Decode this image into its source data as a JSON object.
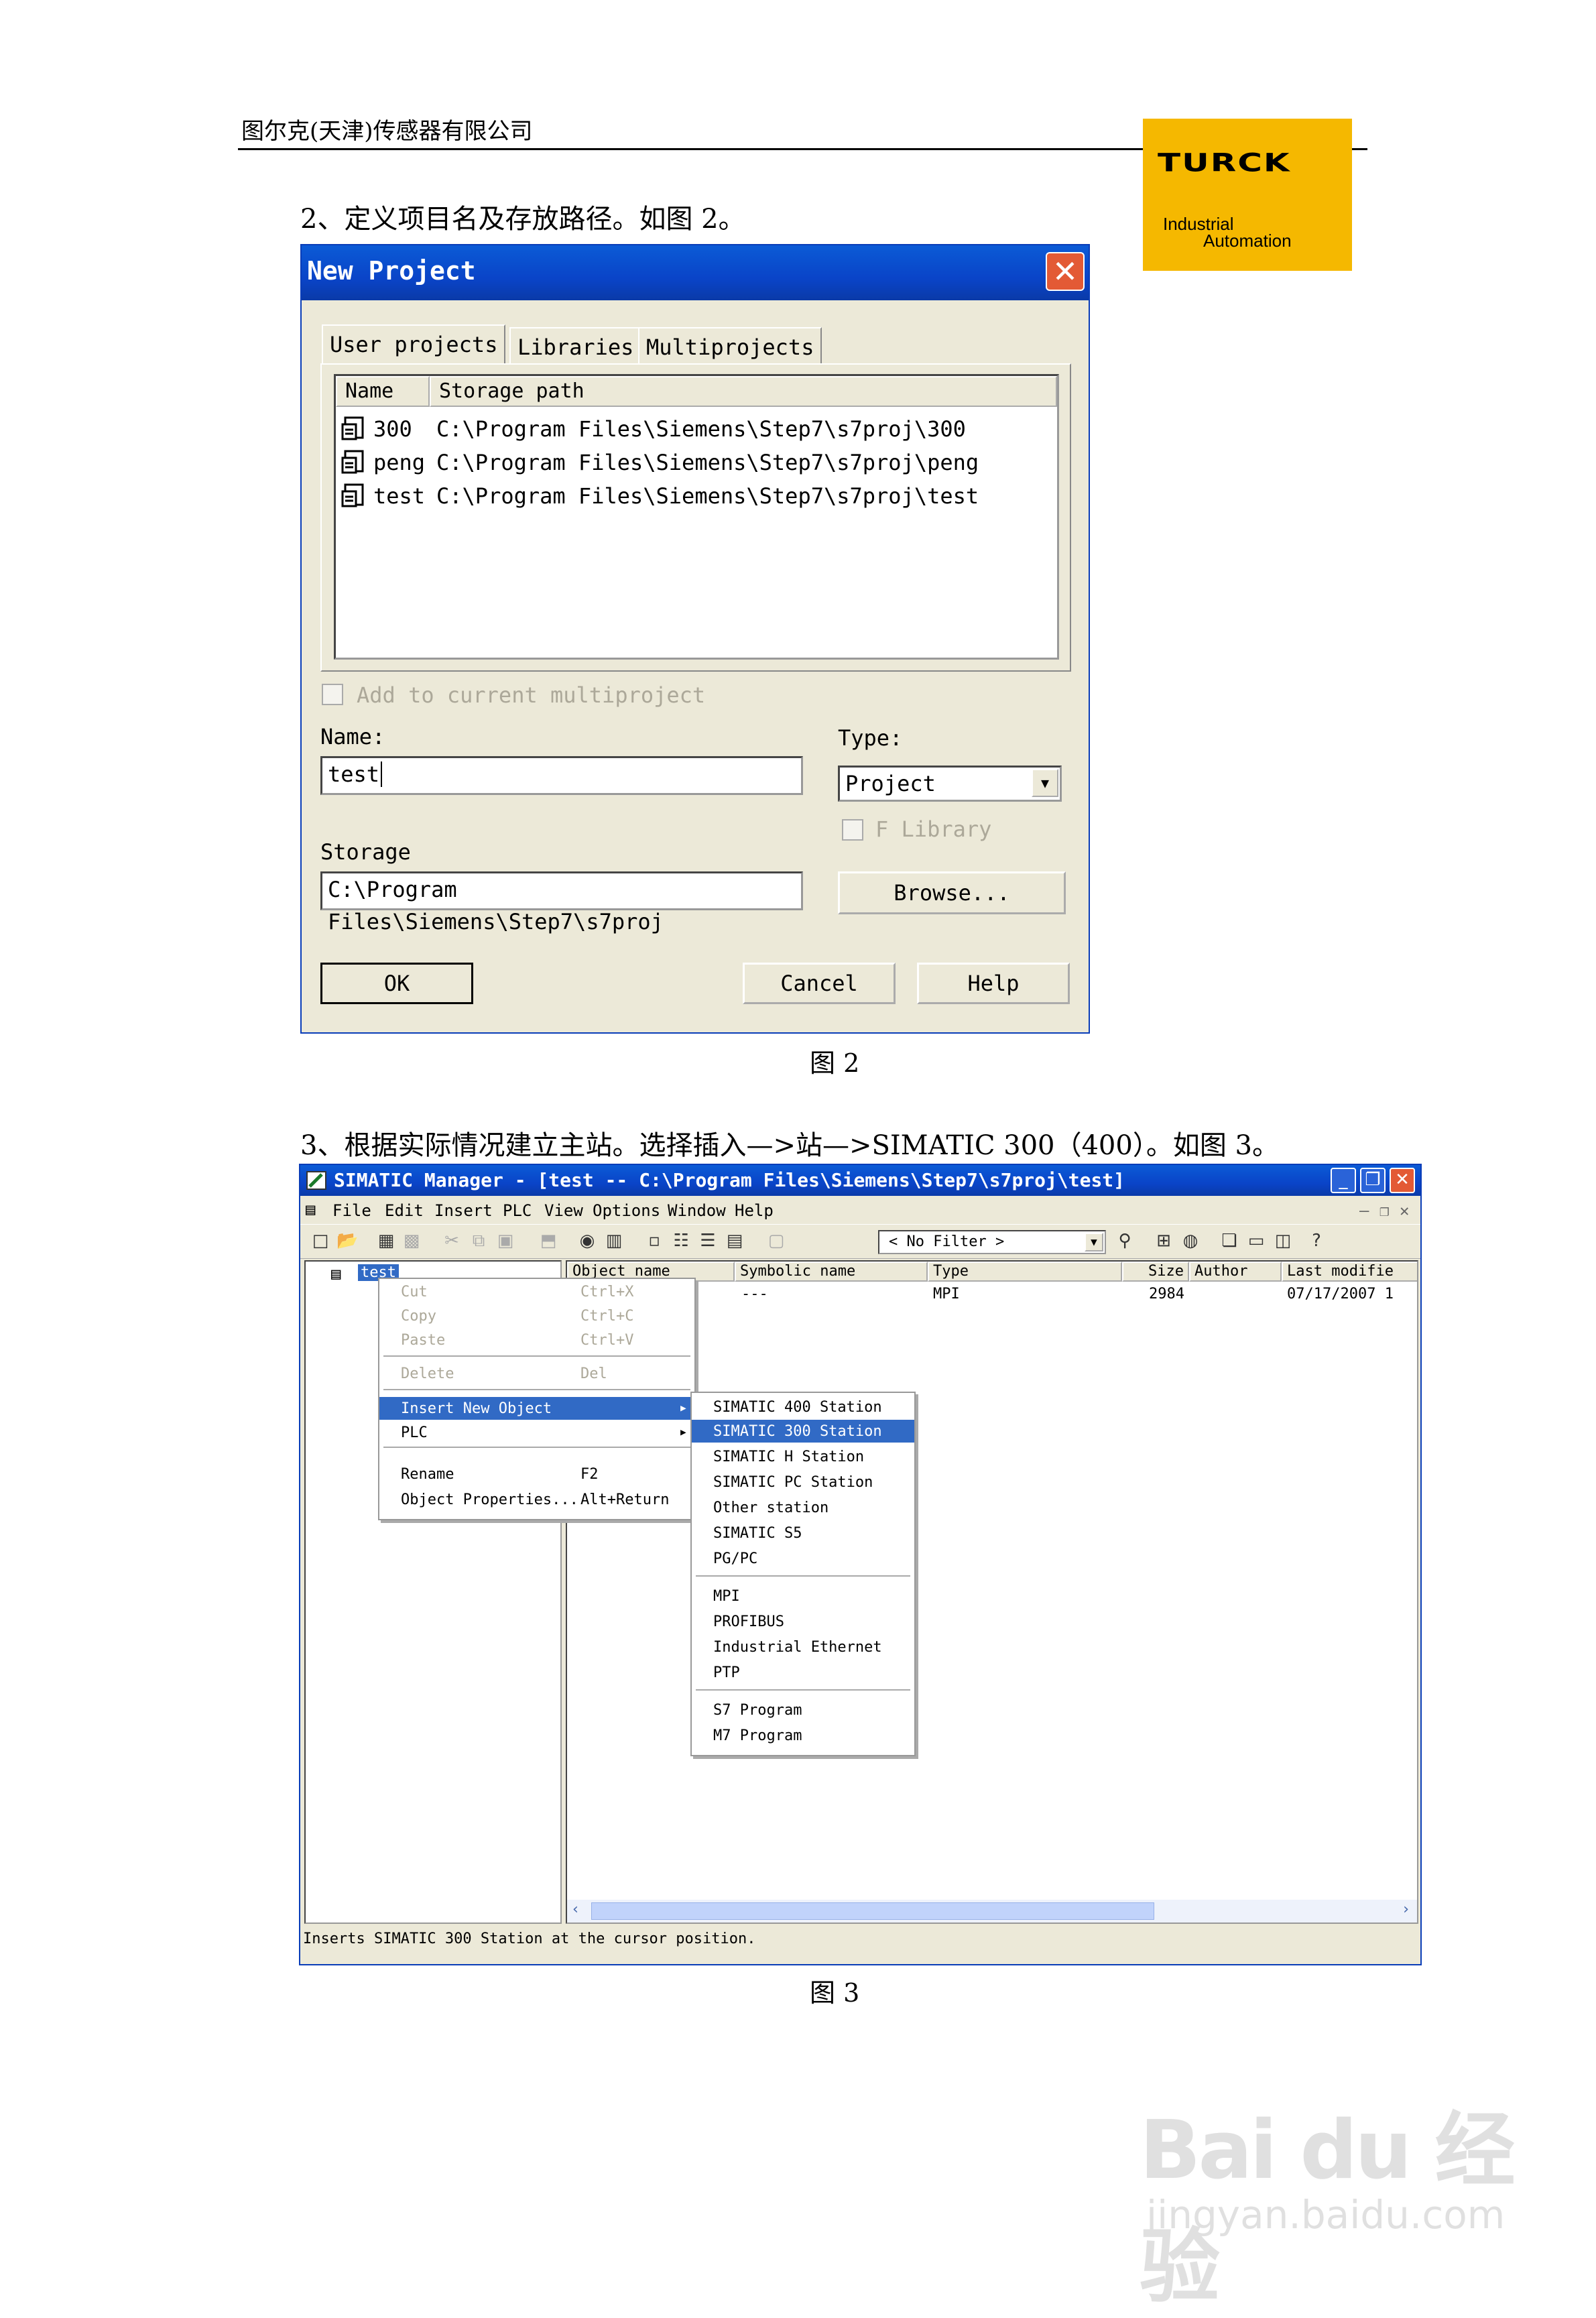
{
  "header": {
    "company": "图尔克(天津)传感器有限公司",
    "logo": {
      "brand": "TURCK",
      "line1": "Industrial",
      "line2": "Automation"
    }
  },
  "step2": {
    "text": "2、定义项目名及存放路径。如图 2。",
    "caption": "图 2"
  },
  "dialog1": {
    "title": "New Project",
    "tabs": [
      "User projects",
      "Libraries",
      "Multiprojects"
    ],
    "columns": [
      "Name",
      "Storage path"
    ],
    "rows": [
      {
        "name": "300",
        "path": "C:\\Program Files\\Siemens\\Step7\\s7proj\\300"
      },
      {
        "name": "peng",
        "path": "C:\\Program Files\\Siemens\\Step7\\s7proj\\peng"
      },
      {
        "name": "test",
        "path": "C:\\Program Files\\Siemens\\Step7\\s7proj\\test"
      }
    ],
    "add_to_multiproject": "Add to current multiproject",
    "name_label": "Name:",
    "name_value": "test",
    "type_label": "Type:",
    "type_value": "Project",
    "f_library": "F Library",
    "storage_label": "Storage",
    "storage_value": "C:\\Program Files\\Siemens\\Step7\\s7proj",
    "browse": "Browse...",
    "ok": "OK",
    "cancel": "Cancel",
    "help": "Help"
  },
  "step3": {
    "text": "3、根据实际情况建立主站。选择插入—>站—>SIMATIC 300（400）。如图 3。",
    "caption": "图 3"
  },
  "window2": {
    "title": "SIMATIC Manager - [test -- C:\\Program Files\\Siemens\\Step7\\s7proj\\test]",
    "menu": [
      "File",
      "Edit",
      "Insert",
      "PLC",
      "View",
      "Options",
      "Window",
      "Help"
    ],
    "filter": "< No Filter >",
    "tree_item": "test",
    "columns": [
      "Object name",
      "Symbolic name",
      "Type",
      "Size",
      "Author",
      "Last modifie"
    ],
    "row": {
      "symbolic": "---",
      "type": "MPI",
      "size": "2984",
      "modified": "07/17/2007 1"
    },
    "status": "Inserts SIMATIC 300 Station at the cursor position.",
    "context_menu": [
      {
        "label": "Cut",
        "shortcut": "Ctrl+X"
      },
      {
        "label": "Copy",
        "shortcut": "Ctrl+C"
      },
      {
        "label": "Paste",
        "shortcut": "Ctrl+V"
      },
      {
        "label": "Delete",
        "shortcut": "Del"
      },
      {
        "label": "Insert New Object",
        "shortcut": ""
      },
      {
        "label": "PLC",
        "shortcut": ""
      },
      {
        "label": "Rename",
        "shortcut": "F2"
      },
      {
        "label": "Object Properties...",
        "shortcut": "Alt+Return"
      }
    ],
    "submenu": [
      "SIMATIC 400 Station",
      "SIMATIC 300 Station",
      "SIMATIC H Station",
      "SIMATIC PC Station",
      "Other station",
      "SIMATIC S5",
      "PG/PC",
      "MPI",
      "PROFIBUS",
      "Industrial Ethernet",
      "PTP",
      "S7 Program",
      "M7 Program"
    ]
  },
  "watermark": {
    "brand": "Bai du 经验",
    "url": "jingyan.baidu.com"
  }
}
